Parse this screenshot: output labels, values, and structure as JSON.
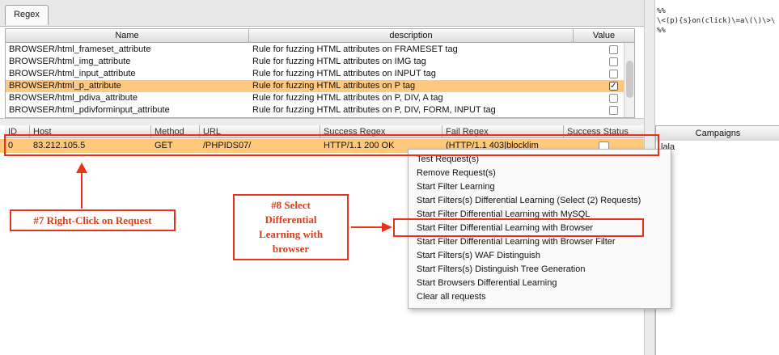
{
  "tab": {
    "label": "Regex"
  },
  "rules_table": {
    "headers": [
      "Name",
      "description",
      "Value"
    ],
    "rows": [
      {
        "name": "BROWSER/html_frameset_attribute",
        "description": "Rule for fuzzing HTML attributes on FRAMESET tag",
        "checked": false
      },
      {
        "name": "BROWSER/html_img_attribute",
        "description": "Rule for fuzzing HTML attributes on IMG tag",
        "checked": false
      },
      {
        "name": "BROWSER/html_input_attribute",
        "description": "Rule for fuzzing HTML attributes on INPUT tag",
        "checked": false
      },
      {
        "name": "BROWSER/html_p_attribute",
        "description": "Rule for fuzzing HTML attributes on P tag",
        "checked": true,
        "selected": true
      },
      {
        "name": "BROWSER/html_pdiva_attribute",
        "description": "Rule for fuzzing HTML attributes on P, DIV, A tag",
        "checked": false
      },
      {
        "name": "BROWSER/html_pdivforminput_attribute",
        "description": "Rule for fuzzing HTML attributes on P, DIV, FORM, INPUT tag",
        "checked": false
      }
    ]
  },
  "regex_text": {
    "line1": "%%",
    "line2": "\\<(p){s}on(click)\\=a\\(\\)\\>\\",
    "line3": "%%"
  },
  "requests_table": {
    "headers": [
      "ID",
      "Host",
      "Method",
      "URL",
      "Success Regex",
      "Fail Regex",
      "Success Status"
    ],
    "row": {
      "id": "0",
      "host": "83.212.105.5",
      "method": "GET",
      "url": "/PHPIDS07/",
      "success_regex": "HTTP/1.1 200 OK",
      "fail_regex": "(HTTP/1.1 403|blocklim"
    }
  },
  "campaigns": {
    "header": "Campaigns",
    "item": "lala"
  },
  "context_menu": {
    "items": [
      "Test Request(s)",
      "Remove Request(s)",
      "Start Filter Learning",
      "Start Filters(s) Differential Learning (Select (2) Requests)",
      "Start Filter Differential Learning with MySQL",
      "Start Filter Differential Learning with Browser",
      "Start Filter Differential Learning with Browser Filter",
      "Start Filters(s) WAF Distinguish",
      "Start Filters(s) Distinguish Tree Generation",
      "Start Browsers Differential Learning",
      "Clear all requests"
    ]
  },
  "annotations": {
    "step7": "#7 Right-Click on Request",
    "step8_line1": "#8 Select",
    "step8_line2": "Differential",
    "step8_line3": "Learning with",
    "step8_line4": "browser",
    "color": "#e8321b"
  },
  "colors": {
    "selection": "#ffc87d"
  }
}
